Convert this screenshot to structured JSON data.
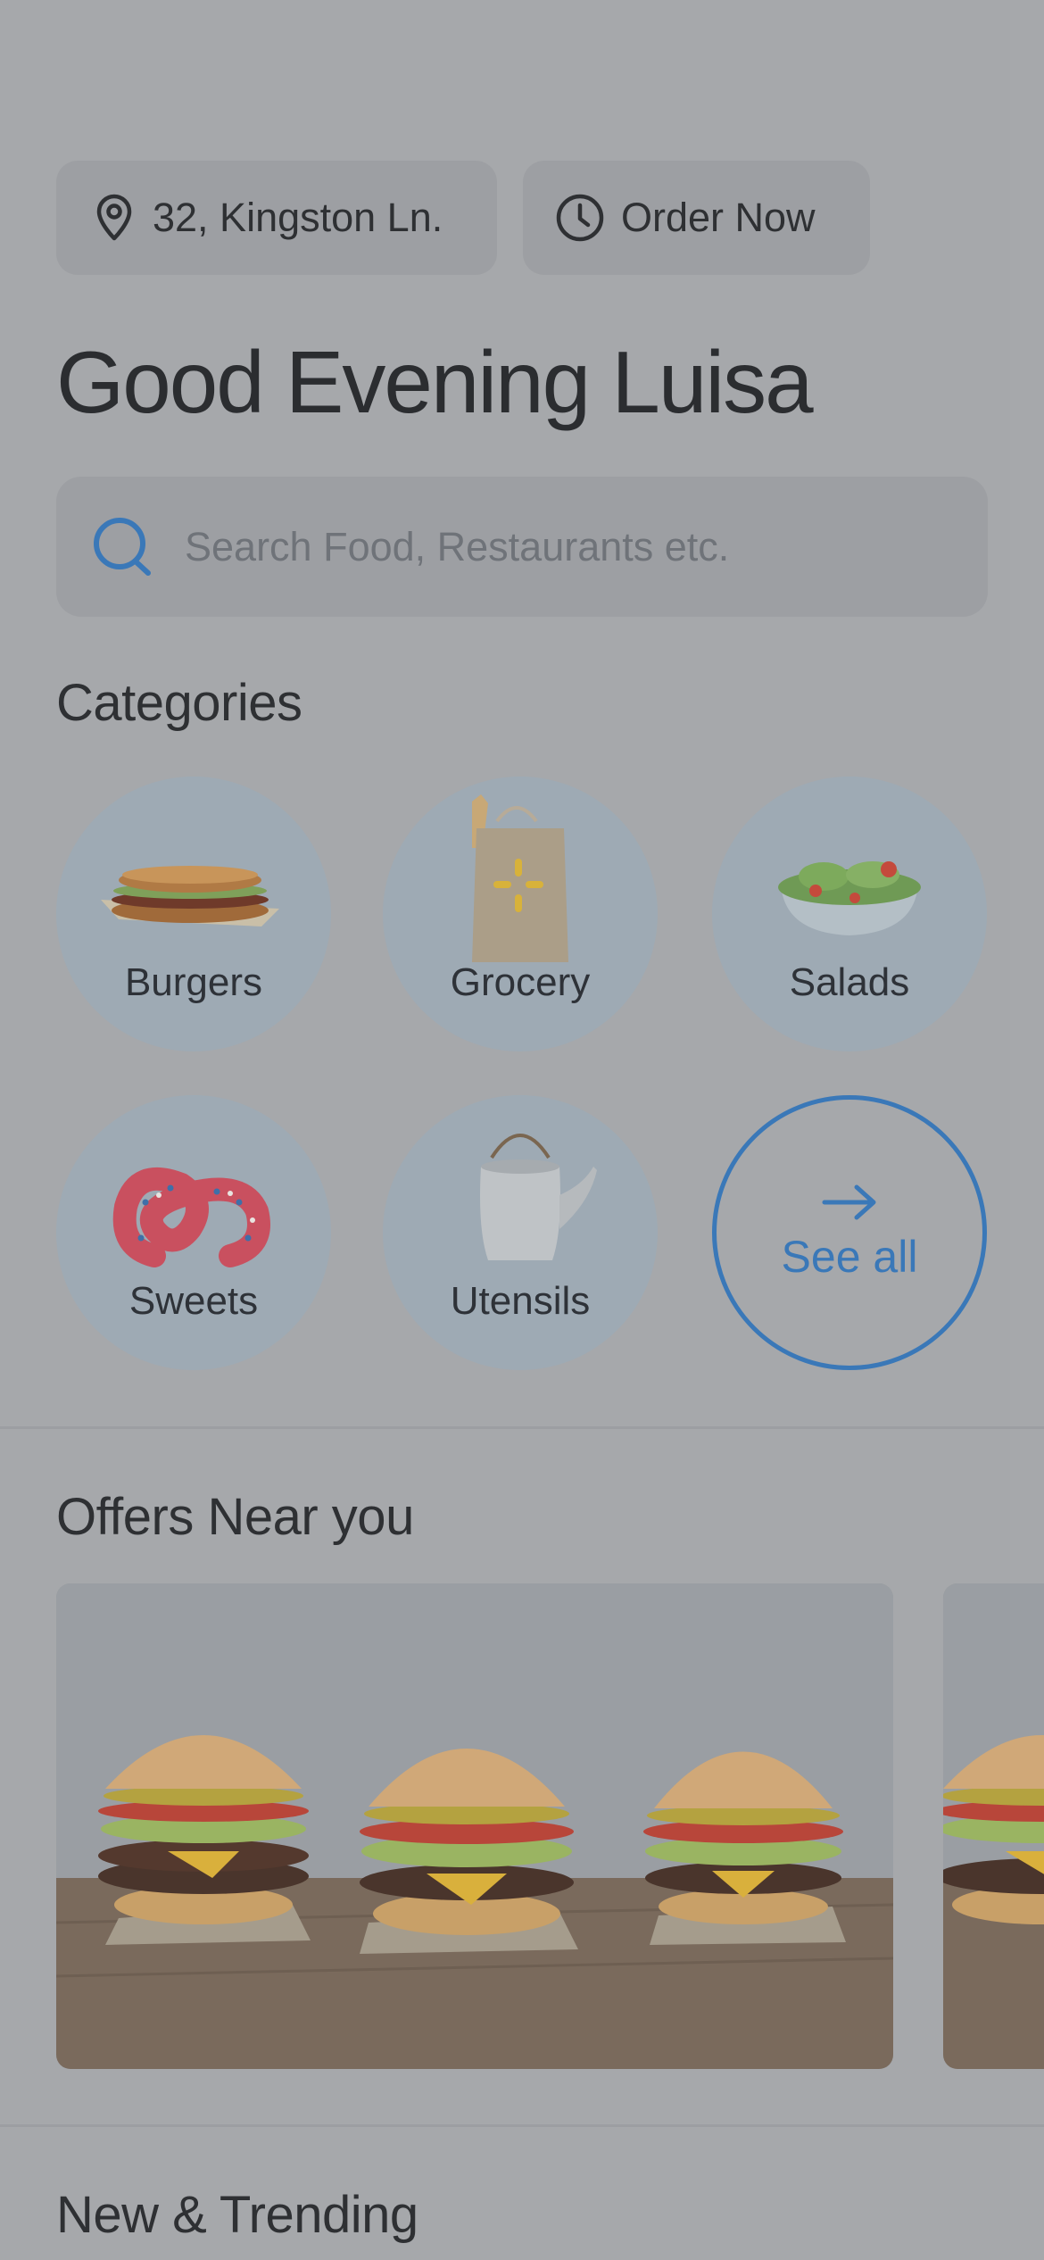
{
  "header": {
    "address_label": "32, Kingston Ln.",
    "order_label": "Order Now",
    "greeting": "Good Evening Luisa"
  },
  "search": {
    "placeholder": "Search Food, Restaurants etc."
  },
  "categories": {
    "title": "Categories",
    "items": [
      {
        "label": "Burgers",
        "icon": "sandwich-icon"
      },
      {
        "label": "Grocery",
        "icon": "grocery-bag-icon"
      },
      {
        "label": "Salads",
        "icon": "salad-bowl-icon"
      },
      {
        "label": "Sweets",
        "icon": "pretzel-icon"
      },
      {
        "label": "Utensils",
        "icon": "teapot-icon"
      }
    ],
    "see_all_label": "See all"
  },
  "offers": {
    "title": "Offers Near you"
  },
  "trending": {
    "title": "New & Trending"
  },
  "colors": {
    "accent": "#3a78b8",
    "overlay_background": "#a6a8ab",
    "category_circle": "#9eaab4"
  }
}
